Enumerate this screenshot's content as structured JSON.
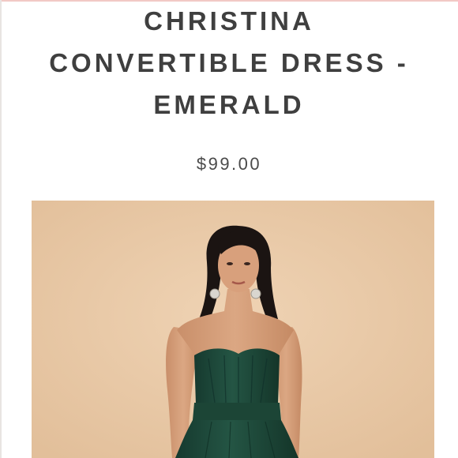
{
  "product": {
    "title_lines": [
      "CHRISTINA",
      "CONVERTIBLE DRESS -",
      "EMERALD"
    ],
    "price": "$99.00"
  },
  "image": {
    "subject_icon": "model-in-emerald-dress-photo",
    "background_color": "#e9c9a6",
    "dress_color": "#1f4a3c"
  }
}
